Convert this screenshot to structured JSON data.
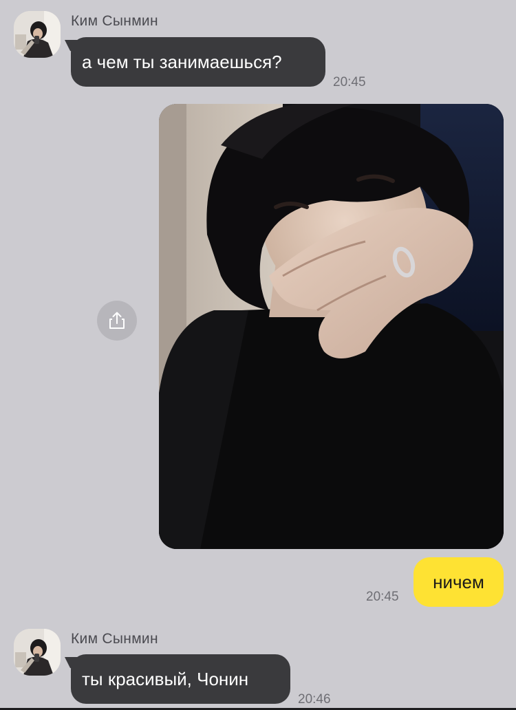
{
  "colors": {
    "background": "#cccbd0",
    "incoming_bubble": "#3a3a3d",
    "outgoing_bubble": "#fee233",
    "timestamp": "#6e6e74"
  },
  "messages": [
    {
      "type": "text",
      "direction": "incoming",
      "sender": "Ким Сынмин",
      "text": "а чем ты занимаешься?",
      "time": "20:45"
    },
    {
      "type": "photo",
      "direction": "outgoing",
      "icon": "share-icon"
    },
    {
      "type": "text",
      "direction": "outgoing",
      "text": "ничем",
      "time": "20:45"
    },
    {
      "type": "text",
      "direction": "incoming",
      "sender": "Ким Сынмин",
      "text": "ты красивый, Чонин",
      "time": "20:46"
    }
  ]
}
